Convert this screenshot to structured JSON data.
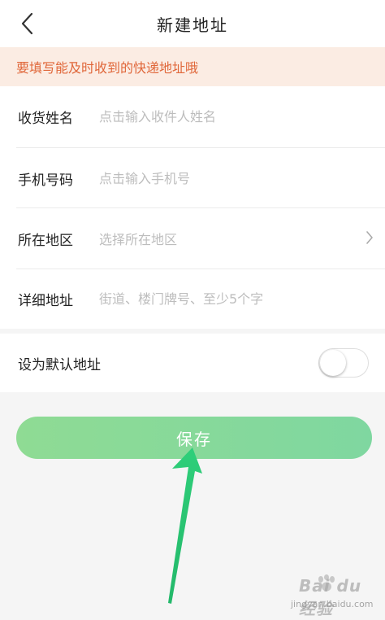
{
  "header": {
    "title": "新建地址",
    "back_icon": "chevron-left-icon"
  },
  "notice": {
    "text": "要填写能及时收到的快递地址哦",
    "color": "#e0673a",
    "background": "#fbece3"
  },
  "form": {
    "recipient_name": {
      "label": "收货姓名",
      "placeholder": "点击输入收件人姓名",
      "value": ""
    },
    "phone": {
      "label": "手机号码",
      "placeholder": "点击输入手机号",
      "value": ""
    },
    "region": {
      "label": "所在地区",
      "placeholder": "选择所在地区",
      "icon": "chevron-right-icon"
    },
    "address_detail": {
      "label": "详细地址",
      "placeholder": "街道、楼门牌号、至少5个字",
      "value": ""
    }
  },
  "default_address": {
    "label": "设为默认地址",
    "enabled": false
  },
  "save_button": {
    "label": "保存",
    "color": "#8fdb94"
  },
  "annotation": {
    "icon": "arrow-up-icon",
    "color": "#2fcf7a"
  },
  "watermark": {
    "text": "Bai du 经验",
    "subtext": "jingyan.baidu.com"
  }
}
